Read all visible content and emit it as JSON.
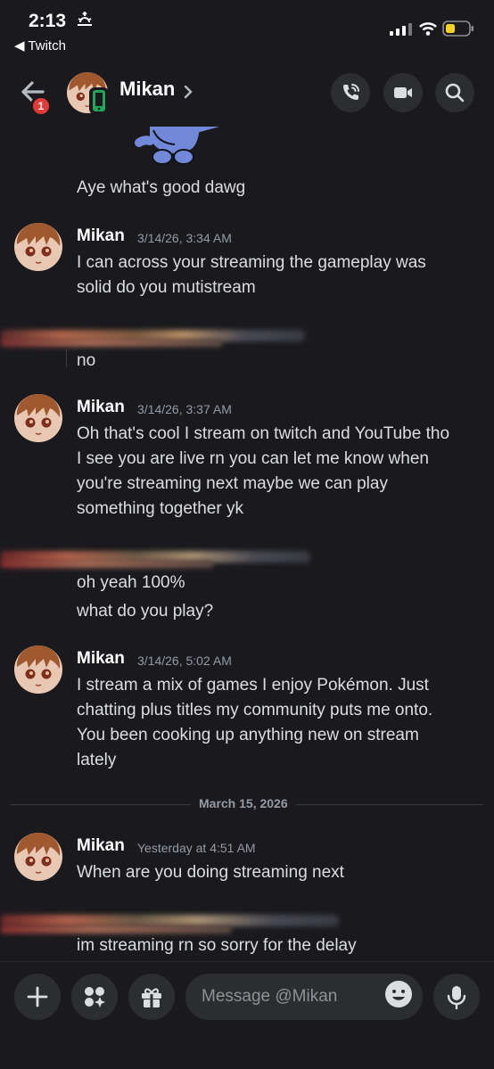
{
  "status_bar": {
    "time": "2:13",
    "back_app": "◀ Twitch"
  },
  "header": {
    "back_badge": "1",
    "name": "Mikan"
  },
  "messages": [
    {
      "author": "Mikan",
      "timestamp": "3/14/26, 3:34 AM",
      "lines": [
        "I can across your streaming the gameplay was",
        "solid do you mutistream"
      ]
    },
    {
      "author": "Mikan",
      "timestamp": "3/14/26, 3:37 AM",
      "lines": [
        "Oh that's cool I stream on twitch and YouTube tho",
        "I see you are live rn you can let me know when",
        "you're streaming next maybe we can play",
        "something together yk"
      ]
    },
    {
      "author": "Mikan",
      "timestamp": "3/14/26, 5:02 AM",
      "lines": [
        "I stream a mix of games I enjoy Pokémon. Just",
        "chatting plus titles my community puts me onto.",
        "You been cooking up anything new on stream",
        "lately"
      ]
    },
    {
      "author": "Mikan",
      "timestamp": "Yesterday at 4:51 AM",
      "lines": [
        "When are you doing streaming next"
      ]
    }
  ],
  "other_messages": {
    "top": "Aye what's good dawg",
    "reply1": "no",
    "reply2a": "oh yeah 100%",
    "reply2b": "what do you play?",
    "reply3": "im streaming rn so sorry for the delay"
  },
  "date_divider": "March 15, 2026",
  "composer": {
    "placeholder": "Message @Mikan"
  },
  "colors": {
    "background": "#1a1a1e",
    "button": "#2b2d31",
    "badge": "#e53935",
    "mascot": "#7289da"
  }
}
